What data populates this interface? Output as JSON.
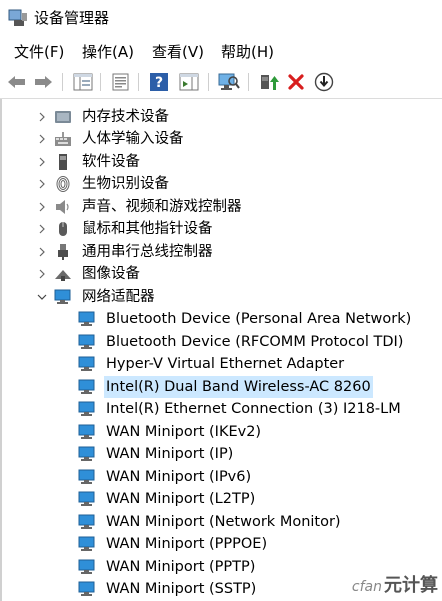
{
  "window": {
    "title": "设备管理器"
  },
  "menu": [
    "文件(F)",
    "操作(A)",
    "查看(V)",
    "帮助(H)"
  ],
  "toolbar": {
    "buttons": [
      "back-icon",
      "forward-icon",
      "show-hide-tree-icon",
      "properties-icon",
      "help-icon",
      "action-pane-icon",
      "scan-hardware-icon",
      "update-driver-icon",
      "uninstall-icon",
      "disable-device-icon"
    ]
  },
  "tree": {
    "categories": [
      {
        "label": "内存技术设备",
        "icon": "memory-icon"
      },
      {
        "label": "人体学输入设备",
        "icon": "hid-icon"
      },
      {
        "label": "软件设备",
        "icon": "software-icon"
      },
      {
        "label": "生物识别设备",
        "icon": "fingerprint-icon"
      },
      {
        "label": "声音、视频和游戏控制器",
        "icon": "speaker-icon"
      },
      {
        "label": "鼠标和其他指针设备",
        "icon": "mouse-icon"
      },
      {
        "label": "通用串行总线控制器",
        "icon": "usb-icon"
      },
      {
        "label": "图像设备",
        "icon": "camera-icon"
      },
      {
        "label": "网络适配器",
        "icon": "network-icon",
        "expanded": true
      }
    ],
    "network_adapters": [
      "Bluetooth Device (Personal Area Network)",
      "Bluetooth Device (RFCOMM Protocol TDI)",
      "Hyper-V Virtual Ethernet Adapter",
      "Intel(R) Dual Band Wireless-AC 8260",
      "Intel(R) Ethernet Connection (3) I218-LM",
      "WAN Miniport (IKEv2)",
      "WAN Miniport (IP)",
      "WAN Miniport (IPv6)",
      "WAN Miniport (L2TP)",
      "WAN Miniport (Network Monitor)",
      "WAN Miniport (PPPOE)",
      "WAN Miniport (PPTP)",
      "WAN Miniport (SSTP)"
    ],
    "selected_adapter": "Intel(R) Dual Band Wireless-AC 8260"
  },
  "watermark": {
    "site": "cfan",
    "text": "元计算"
  },
  "colors": {
    "selection": "#cce8ff",
    "monitor_blue": "#2f8fd8"
  }
}
